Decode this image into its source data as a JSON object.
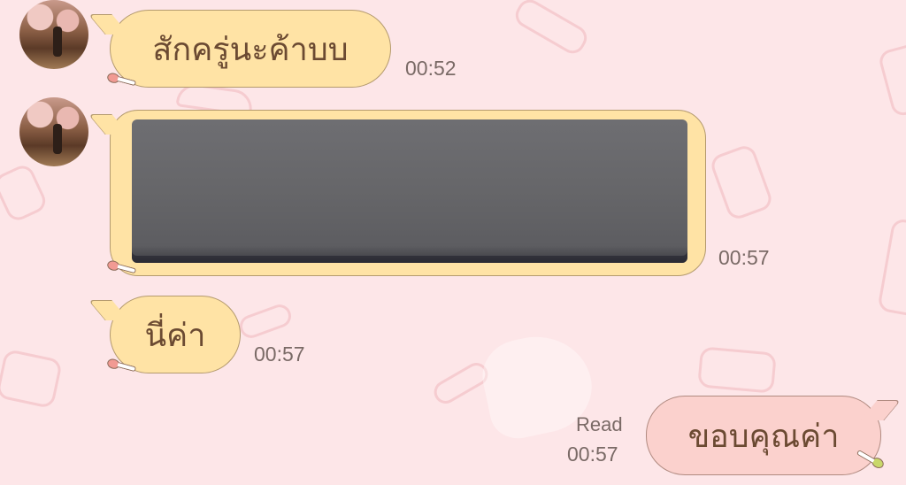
{
  "chat": {
    "messages": [
      {
        "direction": "incoming",
        "type": "text",
        "text": "สักครู่นะค้าบบ",
        "time": "00:52",
        "avatar_icon": "profile-photo"
      },
      {
        "direction": "incoming",
        "type": "image",
        "image_icon": "photo-attachment",
        "time": "00:57",
        "avatar_icon": "profile-photo"
      },
      {
        "direction": "incoming",
        "type": "text",
        "text": "นี่ค่า",
        "time": "00:57"
      },
      {
        "direction": "outgoing",
        "type": "text",
        "text": "ขอบคุณค่า",
        "read_status": "Read",
        "time": "00:57"
      }
    ]
  },
  "colors": {
    "background": "#fde6e8",
    "incoming_bubble": "#ffe3a5",
    "outgoing_bubble": "#fbd1cd",
    "timestamp": "#7a6a66",
    "bubble_text": "#6b4a32"
  }
}
